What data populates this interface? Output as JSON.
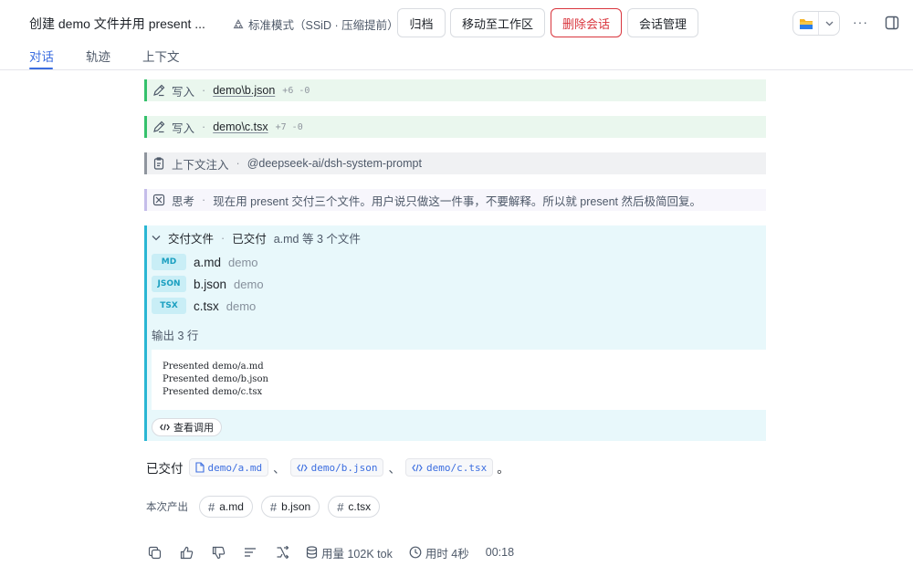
{
  "header": {
    "title": "创建 demo 文件并用 present ...",
    "mode_label": "标准模式（SSiD · 压缩提前）",
    "buttons": {
      "archive": "归档",
      "move": "移动至工作区",
      "delete": "删除会话",
      "manage": "会话管理"
    },
    "more": "···"
  },
  "tabs": [
    {
      "label": "对话",
      "active": true
    },
    {
      "label": "轨迹",
      "active": false
    },
    {
      "label": "上下文",
      "active": false
    }
  ],
  "tool_rows": {
    "write1": {
      "action": "写入",
      "path": "demo\\b.json",
      "diff": "+6 -0"
    },
    "write2": {
      "action": "写入",
      "path": "demo\\c.tsx",
      "diff": "+7 -0"
    },
    "context": {
      "action": "上下文注入",
      "detail": "@deepseek-ai/dsh-system-prompt"
    },
    "think": {
      "action": "思考",
      "detail": "现在用 present 交付三个文件。用户说只做这一件事，不要解释。所以就 present 然后极简回复。"
    }
  },
  "deliver": {
    "title": "交付文件",
    "status": "已交付",
    "summary": "a.md 等 3 个文件",
    "files": [
      {
        "badge": "MD",
        "name": "a.md",
        "dir": "demo"
      },
      {
        "badge": "JSON",
        "name": "b.json",
        "dir": "demo"
      },
      {
        "badge": "TSX",
        "name": "c.tsx",
        "dir": "demo"
      }
    ],
    "output_label": "输出 3 行",
    "output_lines": [
      "Presented demo/a.md",
      "Presented demo/b.json",
      "Presented demo/c.tsx"
    ],
    "view_call": "查看调用"
  },
  "message": {
    "prefix": "已交付",
    "chips": [
      "demo/a.md",
      "demo/b.json",
      "demo/c.tsx"
    ],
    "separator": "、",
    "suffix": "。"
  },
  "produced": {
    "label": "本次产出",
    "tags": [
      "a.md",
      "b.json",
      "c.tsx"
    ]
  },
  "footer": {
    "usage": "用量 102K tok",
    "duration": "用时 4秒",
    "time": "00:18"
  },
  "colors": {
    "accent": "#3c6ee0",
    "danger": "#d9363e",
    "write_bar": "#34c16b",
    "deliver_bar": "#29b6d3"
  }
}
